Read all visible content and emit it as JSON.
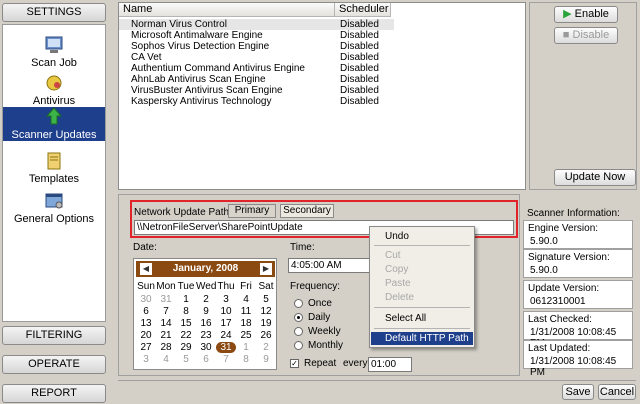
{
  "nav": {
    "settings": "SETTINGS",
    "filtering": "FILTERING",
    "operate": "OPERATE",
    "report": "REPORT",
    "items": [
      {
        "label": "Scan Job",
        "icon": "scan-job-icon"
      },
      {
        "label": "Antivirus",
        "icon": "antivirus-icon"
      },
      {
        "label": "Scanner Updates",
        "icon": "scanner-updates-icon"
      },
      {
        "label": "Templates",
        "icon": "templates-icon"
      },
      {
        "label": "General Options",
        "icon": "general-options-icon"
      }
    ]
  },
  "scanner_list": {
    "col_name": "Name",
    "col_scheduler": "Scheduler",
    "rows": [
      {
        "name": "Norman Virus Control",
        "scheduler": "Disabled"
      },
      {
        "name": "Microsoft Antimalware Engine",
        "scheduler": "Disabled"
      },
      {
        "name": "Sophos Virus Detection Engine",
        "scheduler": "Disabled"
      },
      {
        "name": "CA Vet",
        "scheduler": "Disabled"
      },
      {
        "name": "Authentium Command Antivirus Engine",
        "scheduler": "Disabled"
      },
      {
        "name": "AhnLab Antivirus Scan Engine",
        "scheduler": "Disabled"
      },
      {
        "name": "VirusBuster Antivirus Scan Engine",
        "scheduler": "Disabled"
      },
      {
        "name": "Kaspersky Antivirus Technology",
        "scheduler": "Disabled"
      }
    ]
  },
  "right_buttons": {
    "enable": "Enable",
    "disable": "Disable",
    "update_now": "Update Now"
  },
  "network": {
    "label": "Network Update Path:",
    "tab_primary": "Primary",
    "tab_secondary": "Secondary",
    "path": "\\\\NetronFileServer\\SharePointUpdate"
  },
  "date": {
    "label": "Date:",
    "month_title": "January, 2008",
    "dow": [
      "Sun",
      "Mon",
      "Tue",
      "Wed",
      "Thu",
      "Fri",
      "Sat"
    ],
    "weeks": [
      [
        "30",
        "31",
        "1",
        "2",
        "3",
        "4",
        "5"
      ],
      [
        "6",
        "7",
        "8",
        "9",
        "10",
        "11",
        "12"
      ],
      [
        "13",
        "14",
        "15",
        "16",
        "17",
        "18",
        "19"
      ],
      [
        "20",
        "21",
        "22",
        "23",
        "24",
        "25",
        "26"
      ],
      [
        "27",
        "28",
        "29",
        "30",
        "31",
        "1",
        "2"
      ],
      [
        "3",
        "4",
        "5",
        "6",
        "7",
        "8",
        "9"
      ]
    ]
  },
  "time": {
    "label": "Time:",
    "value": "4:05:00 AM"
  },
  "frequency": {
    "label": "Frequency:",
    "options": [
      "Once",
      "Daily",
      "Weekly",
      "Monthly"
    ],
    "selected": "Daily"
  },
  "repeat": {
    "label": "Repeat",
    "every": "every",
    "value": "01:00"
  },
  "context_menu": {
    "undo": "Undo",
    "cut": "Cut",
    "copy": "Copy",
    "paste": "Paste",
    "delete": "Delete",
    "select_all": "Select All",
    "default_http": "Default HTTP Path"
  },
  "scanner_info": {
    "title": "Scanner Information:",
    "engine_version_label": "Engine Version:",
    "engine_version": "5.90.0",
    "signature_version_label": "Signature Version:",
    "signature_version": "5.90.0",
    "update_version_label": "Update Version:",
    "update_version": "0612310001",
    "last_checked_label": "Last Checked:",
    "last_checked": "1/31/2008 10:08:45 PM",
    "last_updated_label": "Last Updated:",
    "last_updated": "1/31/2008 10:08:45 PM"
  },
  "footer": {
    "save": "Save",
    "cancel": "Cancel"
  },
  "colors": {
    "selection": "#1e3f8c",
    "highlight_box": "#e0242a",
    "calendar_header": "#8a4a12"
  }
}
